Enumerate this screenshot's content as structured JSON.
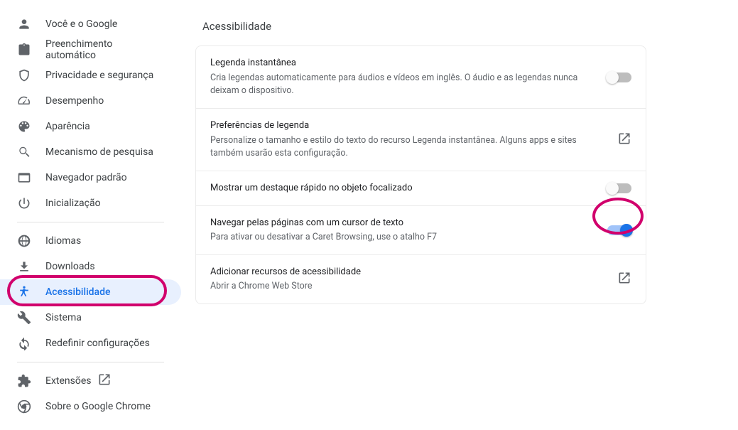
{
  "sidebar": {
    "groups": [
      [
        {
          "icon": "person",
          "label": "Você e o Google"
        },
        {
          "icon": "clipboard",
          "label": "Preenchimento automático"
        },
        {
          "icon": "shield",
          "label": "Privacidade e segurança"
        },
        {
          "icon": "speed",
          "label": "Desempenho"
        },
        {
          "icon": "palette",
          "label": "Aparência"
        },
        {
          "icon": "search",
          "label": "Mecanismo de pesquisa"
        },
        {
          "icon": "browser",
          "label": "Navegador padrão"
        },
        {
          "icon": "power",
          "label": "Inicialização"
        }
      ],
      [
        {
          "icon": "globe",
          "label": "Idiomas"
        },
        {
          "icon": "download",
          "label": "Downloads"
        },
        {
          "icon": "accessibility",
          "label": "Acessibilidade",
          "selected": true,
          "ring": true
        },
        {
          "icon": "wrench",
          "label": "Sistema"
        },
        {
          "icon": "reset",
          "label": "Redefinir configurações"
        }
      ],
      [
        {
          "icon": "extension",
          "label": "Extensões",
          "external": true
        },
        {
          "icon": "chrome",
          "label": "Sobre o Google Chrome"
        }
      ]
    ]
  },
  "main": {
    "title": "Acessibilidade",
    "rows": [
      {
        "title": "Legenda instantânea",
        "subtitle": "Cria legendas automaticamente para áudios e vídeos em inglês. O áudio e as legendas nunca deixam o dispositivo.",
        "action": "toggle",
        "state": "off"
      },
      {
        "title": "Preferências de legenda",
        "subtitle": "Personalize o tamanho e estilo do texto do recurso Legenda instantânea. Alguns apps e sites também usarão esta configuração.",
        "action": "open"
      },
      {
        "title": "Mostrar um destaque rápido no objeto focalizado",
        "action": "toggle",
        "state": "off"
      },
      {
        "title": "Navegar pelas páginas com um cursor de texto",
        "subtitle": "Para ativar ou desativar a Caret Browsing, use o atalho F7",
        "action": "toggle",
        "state": "on",
        "ring": true
      },
      {
        "title": "Adicionar recursos de acessibilidade",
        "subtitle": "Abrir a Chrome Web Store",
        "action": "open"
      }
    ]
  }
}
